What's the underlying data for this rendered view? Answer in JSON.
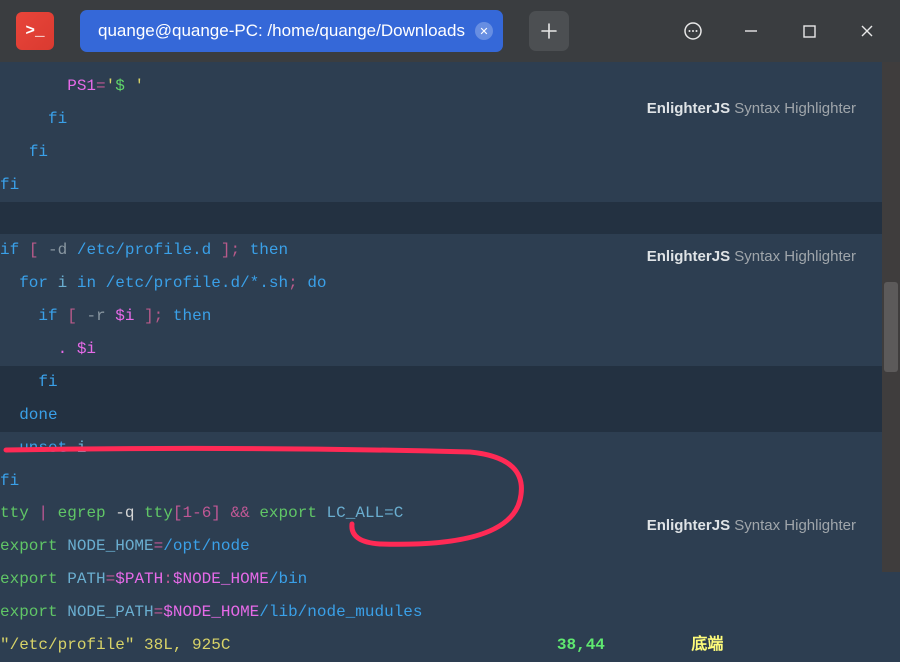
{
  "titlebar": {
    "tab_title": "quange@quange-PC: /home/quange/Downloads"
  },
  "attribution": {
    "strong": "EnlighterJS",
    "rest": " Syntax Highlighter"
  },
  "tokens": {
    "ps1": "PS1",
    "eq": "=",
    "quote": "'",
    "dollar_sp": "$ ",
    "fi": "fi",
    "if": "if",
    "lbrack": "[",
    "rbrack": "]",
    "dash_d": "-d",
    "semi": ";",
    "then": "then",
    "for": "for",
    "i": "i",
    "in": "in",
    "do": "do",
    "dash_r": "-r",
    "dollar_i": "$i",
    "dot": ".",
    "done": "done",
    "unset": "unset",
    "etc_profiled": "/etc/profile.d",
    "etc_profiled_sh": "/etc/profile.d/*.sh",
    "tty": "tty",
    "pipe": "|",
    "egrep": "egrep",
    "dash_q": "-q",
    "tty_re": "tty",
    "re_rest": "[1-6]",
    "amp": "&&",
    "export": "export",
    "lc_all_c": "LC_ALL=C",
    "node_home": "NODE_HOME",
    "opt_node": "/opt/node",
    "path_var": "PATH",
    "d_path": "$PATH",
    "colon": ":",
    "d_node_home": "$NODE_HOME",
    "bin": "/bin",
    "node_path": "NODE_PATH",
    "lib_nm": "/lib/node_mudules",
    "file_q": "\"/etc/profile\"",
    "file_meta": " 38L, 925C"
  },
  "status": {
    "pos": "38,44",
    "end": "底端"
  }
}
